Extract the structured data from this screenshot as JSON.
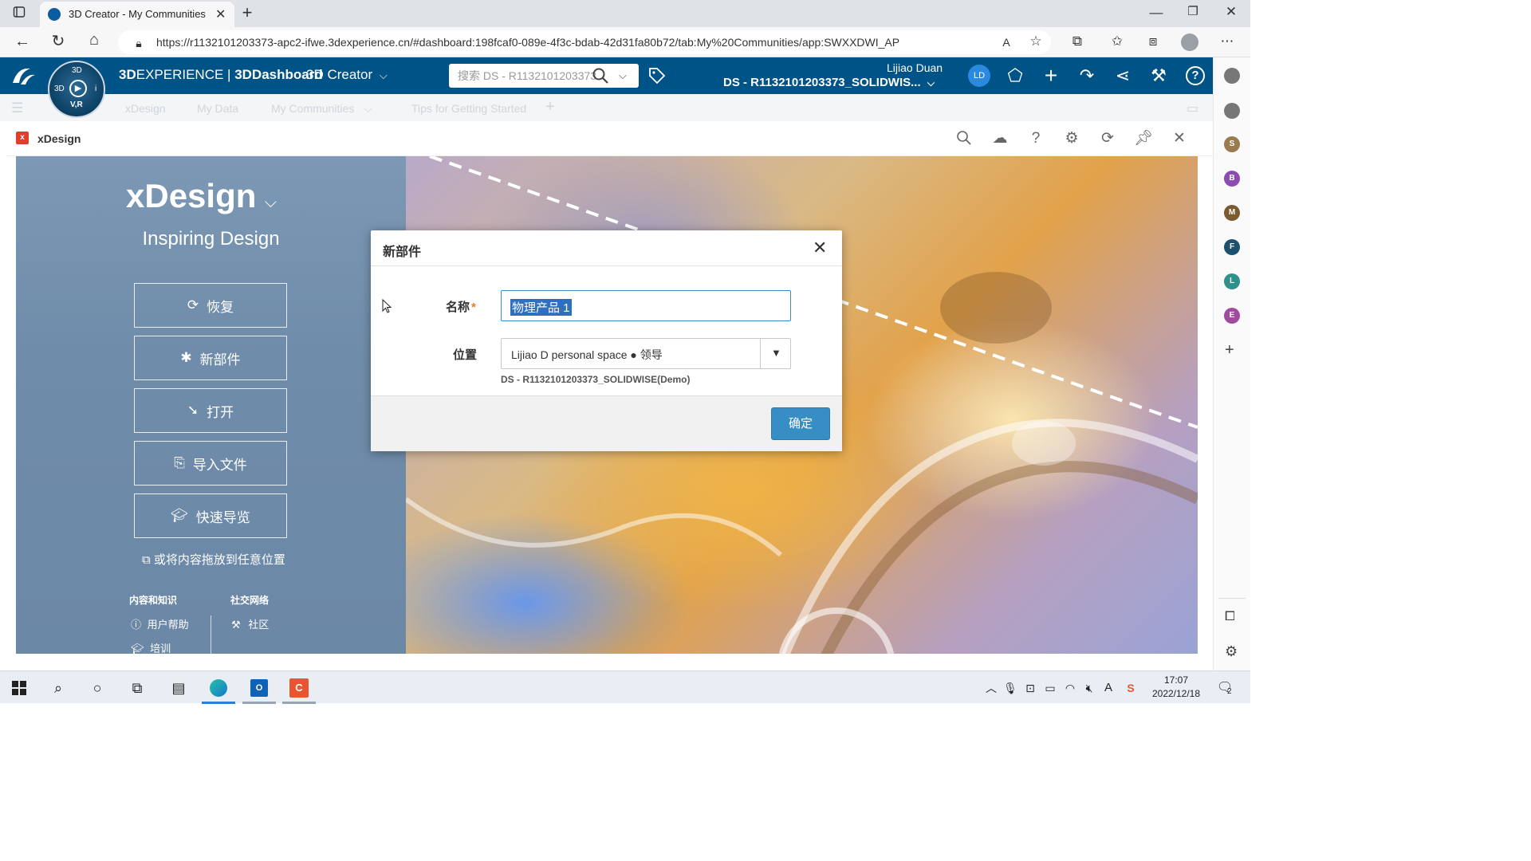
{
  "browser": {
    "tab_title": "3D Creator - My Communities",
    "url": "https://r1132101203373-apc2-ifwe.3dexperience.cn/#dashboard:198fcaf0-089e-4f3c-bdab-42d31fa80b72/tab:My%20Communities/app:SWXXDWI_AP"
  },
  "topbar": {
    "brand_3d": "3D",
    "brand_experience": "EXPERIENCE",
    "separator": " | ",
    "brand_dashboard": "3DDashboard",
    "app_name": "3D Creator",
    "search_placeholder": "搜索 DS - R1132101203373",
    "user_name": "Lijiao Duan",
    "tenant": "DS - R1132101203373_SOLIDWIS...",
    "avatar_initials": "LD",
    "compass": {
      "top": "3D",
      "left": "3D",
      "bottom": "V,R",
      "right": "i"
    }
  },
  "subbar": {
    "tabs": [
      "xDesign",
      "My Data",
      "My Communities",
      "Tips for Getting Started"
    ]
  },
  "widget": {
    "title": "xDesign"
  },
  "left_panel": {
    "app_title": "xDesign",
    "tagline": "Inspiring Design",
    "buttons": [
      {
        "label": "恢复",
        "icon": "restore-icon"
      },
      {
        "label": "新部件",
        "icon": "new-part-icon"
      },
      {
        "label": "打开",
        "icon": "open-icon"
      },
      {
        "label": "导入文件",
        "icon": "import-file-icon"
      },
      {
        "label": "快速导览",
        "icon": "quick-tour-icon"
      }
    ],
    "drag_hint": "或将内容拖放到任意位置",
    "section_content": "内容和知识",
    "section_social": "社交网络",
    "link_help": "用户帮助",
    "link_training": "培训",
    "link_community": "社区"
  },
  "modal": {
    "title": "新部件",
    "name_label": "名称",
    "required_mark": "*",
    "name_value": "物理产品 1",
    "location_label": "位置",
    "location_value": "Lijiao D personal space ● 领导",
    "location_sub": "DS - R1132101203373_SOLIDWISE(Demo)",
    "ok_label": "确定"
  },
  "taskbar": {
    "time": "17:07",
    "date": "2022/12/18",
    "notifications": "2",
    "ime": "A"
  },
  "right_rail": {
    "avatars": [
      "S",
      "B",
      "M",
      "F",
      "L",
      "E"
    ]
  },
  "colors": {
    "topbar": "#005386",
    "accent_blue": "#368ec4",
    "required": "#e87a1c"
  }
}
